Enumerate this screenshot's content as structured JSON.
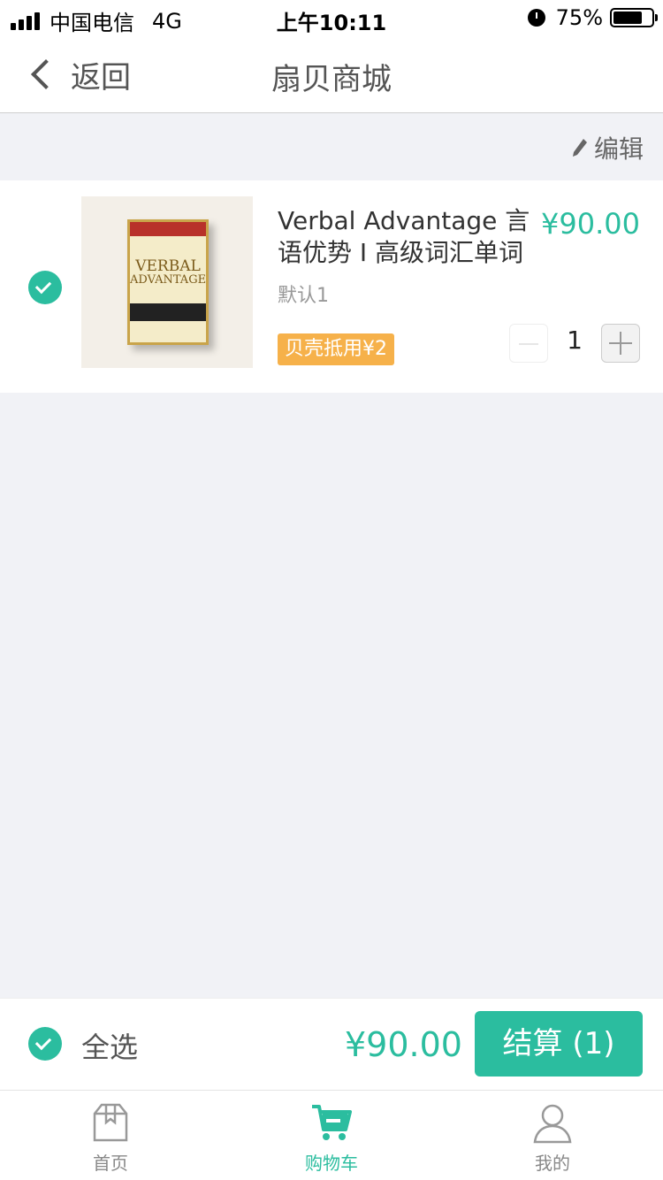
{
  "status_bar": {
    "carrier": "中国电信",
    "network": "4G",
    "time": "上午10:11",
    "battery": "75%"
  },
  "nav": {
    "back_label": "返回",
    "title": "扇贝商城"
  },
  "toolbar": {
    "edit_label": "编辑"
  },
  "cart": {
    "items": [
      {
        "title": "Verbal Advantage 言语优势 I 高级词汇单词",
        "price": "¥90.00",
        "variant": "默认1",
        "coupon": "贝壳抵用¥2",
        "quantity": "1",
        "selected": true,
        "cover_title_line1": "VERBAL",
        "cover_title_line2": "ADVANTAGE"
      }
    ]
  },
  "checkout": {
    "select_all_label": "全选",
    "total": "¥90.00",
    "button_label": "结算 (1)"
  },
  "tabs": [
    {
      "label": "首页",
      "icon": "box-icon",
      "active": false
    },
    {
      "label": "购物车",
      "icon": "cart-icon",
      "active": true
    },
    {
      "label": "我的",
      "icon": "user-icon",
      "active": false
    }
  ],
  "colors": {
    "accent": "#2bbd9f",
    "coupon": "#f6b14a",
    "background": "#f1f2f6"
  }
}
